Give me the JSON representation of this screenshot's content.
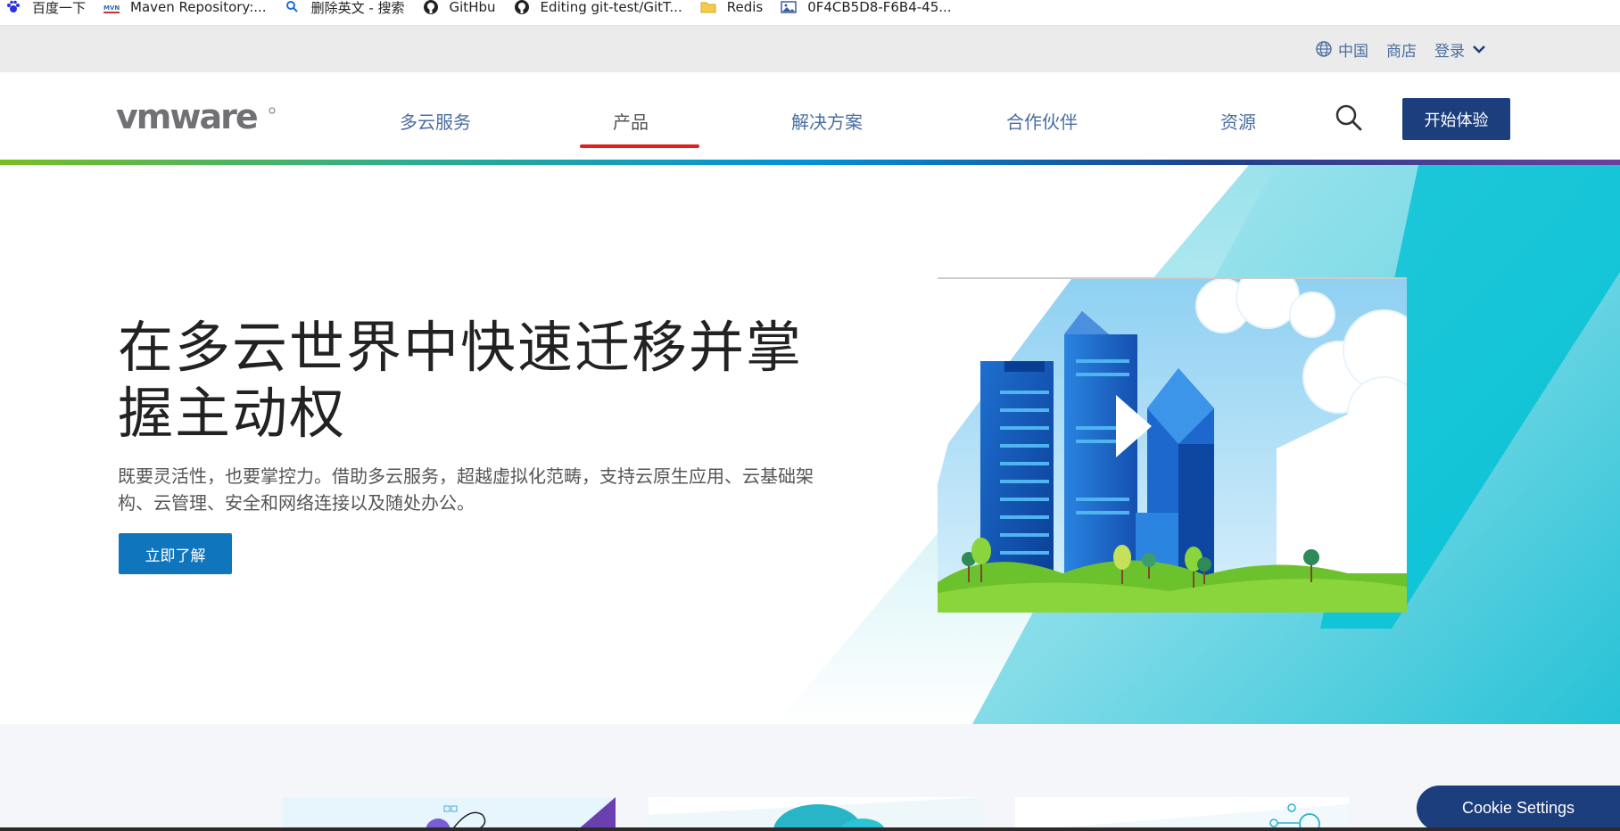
{
  "bookmarks": [
    {
      "label": "百度一下",
      "icon": "baidu-icon"
    },
    {
      "label": "Maven Repository:...",
      "icon": "mvn-icon"
    },
    {
      "label": "删除英文 - 搜索",
      "icon": "search-icon"
    },
    {
      "label": "GitHbu",
      "icon": "github-icon"
    },
    {
      "label": "Editing git-test/GitT...",
      "icon": "github-icon"
    },
    {
      "label": "Redis",
      "icon": "folder-icon"
    },
    {
      "label": "0F4CB5D8-F6B4-45...",
      "icon": "image-icon"
    }
  ],
  "utility": {
    "region": "中国",
    "store": "商店",
    "login": "登录"
  },
  "nav": {
    "logo": "vmware",
    "items": [
      "多云服务",
      "产品",
      "解决方案",
      "合作伙伴",
      "资源"
    ],
    "active_index": 1,
    "cta": "开始体验"
  },
  "hero": {
    "title": "在多云世界中快速迁移并掌握主动权",
    "description": "既要灵活性，也要掌控力。借助多云服务，超越虚拟化范畴，支持云原生应用、云基础架构、云管理、安全和网络连接以及随处办公。",
    "button": "立即了解"
  },
  "cookie": {
    "label": "Cookie Settings"
  },
  "colors": {
    "navy": "#1c3e7c",
    "link_blue": "#4a6ea0",
    "hero_button": "#0f75bc",
    "active_underline": "#e0201a",
    "teal": "#00c1d5"
  }
}
